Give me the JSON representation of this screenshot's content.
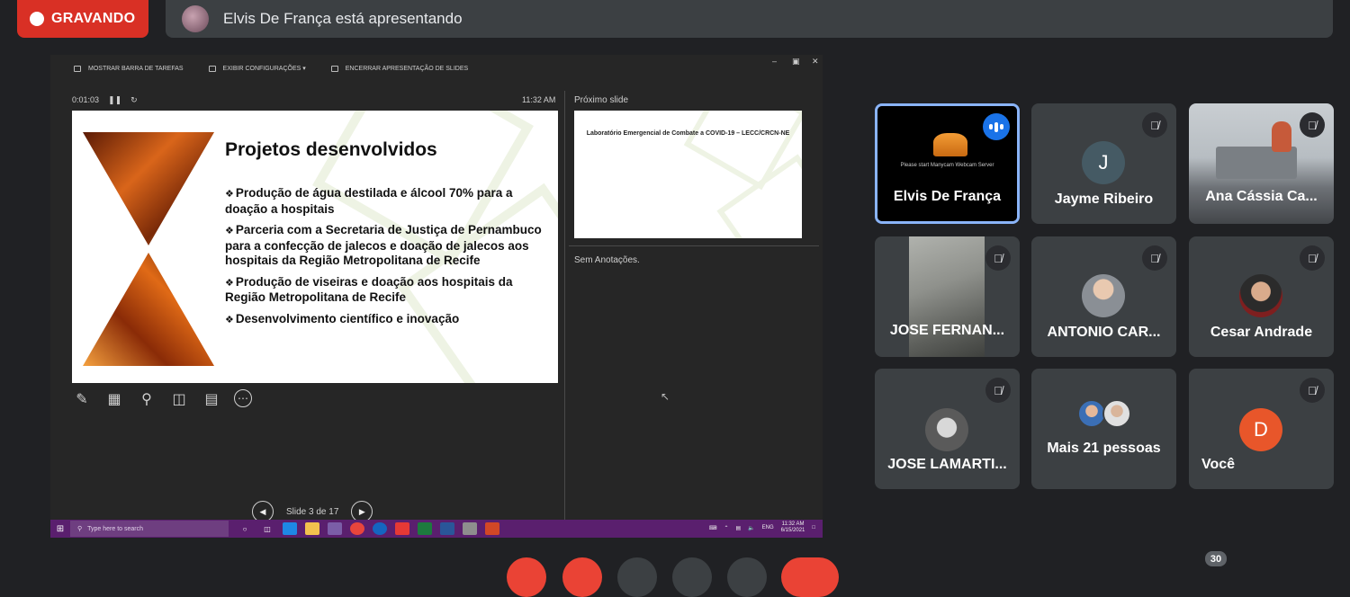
{
  "recording": {
    "label": "GRAVANDO"
  },
  "presenter_bar": {
    "text": "Elvis De França está apresentando"
  },
  "presentation": {
    "toolbar": {
      "show_taskbar": "MOSTRAR BARRA DE TAREFAS",
      "display_settings": "EXIBIR CONFIGURAÇÕES ▾",
      "end_slideshow": "ENCERRAR APRESENTAÇÃO DE SLIDES"
    },
    "timer": "0:01:03",
    "clock": "11:32 AM",
    "next_slide_label": "Próximo slide",
    "slide": {
      "title": "Projetos desenvolvidos",
      "bullets": [
        "Produção de água destilada e álcool 70% para a doação a hospitais",
        "Parceria com a Secretaria de Justiça de Pernambuco para a confecção de jalecos e doação de jalecos aos hospitais da Região Metropolitana de Recife",
        "Produção de viseiras e doação aos hospitais da Região Metropolitana de Recife",
        "Desenvolvimento científico e inovação"
      ]
    },
    "next_slide_title": "Laboratório Emergencial de Combate a COVID-19 – LECC/CRCN-NE",
    "notes": "Sem Anotações.",
    "slide_counter": "Slide 3 de 17",
    "taskbar": {
      "search_placeholder": "Type here to search",
      "lang": "ENG",
      "time": "11:32 AM",
      "date": "6/15/2021"
    }
  },
  "participants": [
    {
      "name": "Elvis De França",
      "status": "speaking",
      "caption": "Please start Manycam Webcam Server"
    },
    {
      "name": "Jayme Ribeiro",
      "initial": "J",
      "muted": true
    },
    {
      "name": "Ana Cássia Ca...",
      "muted": true
    },
    {
      "name": "JOSE FERNAN...",
      "muted": true
    },
    {
      "name": "ANTONIO CAR...",
      "muted": true
    },
    {
      "name": "Cesar Andrade",
      "muted": true
    },
    {
      "name": "JOSE LAMARTI...",
      "muted": true
    },
    {
      "name": "Mais 21 pessoas"
    },
    {
      "name": "Você",
      "initial": "D",
      "muted": true
    }
  ],
  "participant_count_badge": "30",
  "colors": {
    "record": "#d93025",
    "active_border": "#8ab4f8",
    "you_avatar": "#e8562a",
    "jayme_avatar": "#455a64"
  }
}
